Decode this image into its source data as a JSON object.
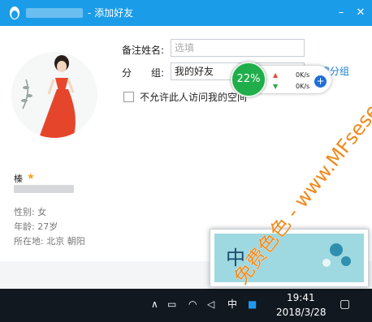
{
  "window": {
    "title": "- 添加好友",
    "minimize_glyph": "–",
    "close_glyph": "✕"
  },
  "profile": {
    "name": "榛",
    "gender": "性别: 女",
    "age": "年龄: 27岁",
    "location": "所在地: 北京  朝阳"
  },
  "form": {
    "remark_label": "备注姓名:",
    "remark_placeholder": "选填",
    "group_label_1": "分",
    "group_label_2": "组:",
    "group_value": "我的好友",
    "new_group_link": "建分组",
    "hide_checkbox_label": "不允许此人访问我的空间"
  },
  "net_widget": {
    "percent": "22%",
    "upload": "0K/s",
    "download": "0K/s",
    "plus": "+"
  },
  "watermark": {
    "text": "免费色色 - www.MFsese.com"
  },
  "thumbnail": {
    "char": "中"
  },
  "taskbar": {
    "chevron": "∧",
    "ime": "中",
    "time": "19:41",
    "date": "2018/3/28"
  },
  "colors": {
    "titlebar": "#1b9ce8",
    "link": "#1b7fd6",
    "watermark": "#f08a1c",
    "widget_green": "#1fae4a"
  }
}
